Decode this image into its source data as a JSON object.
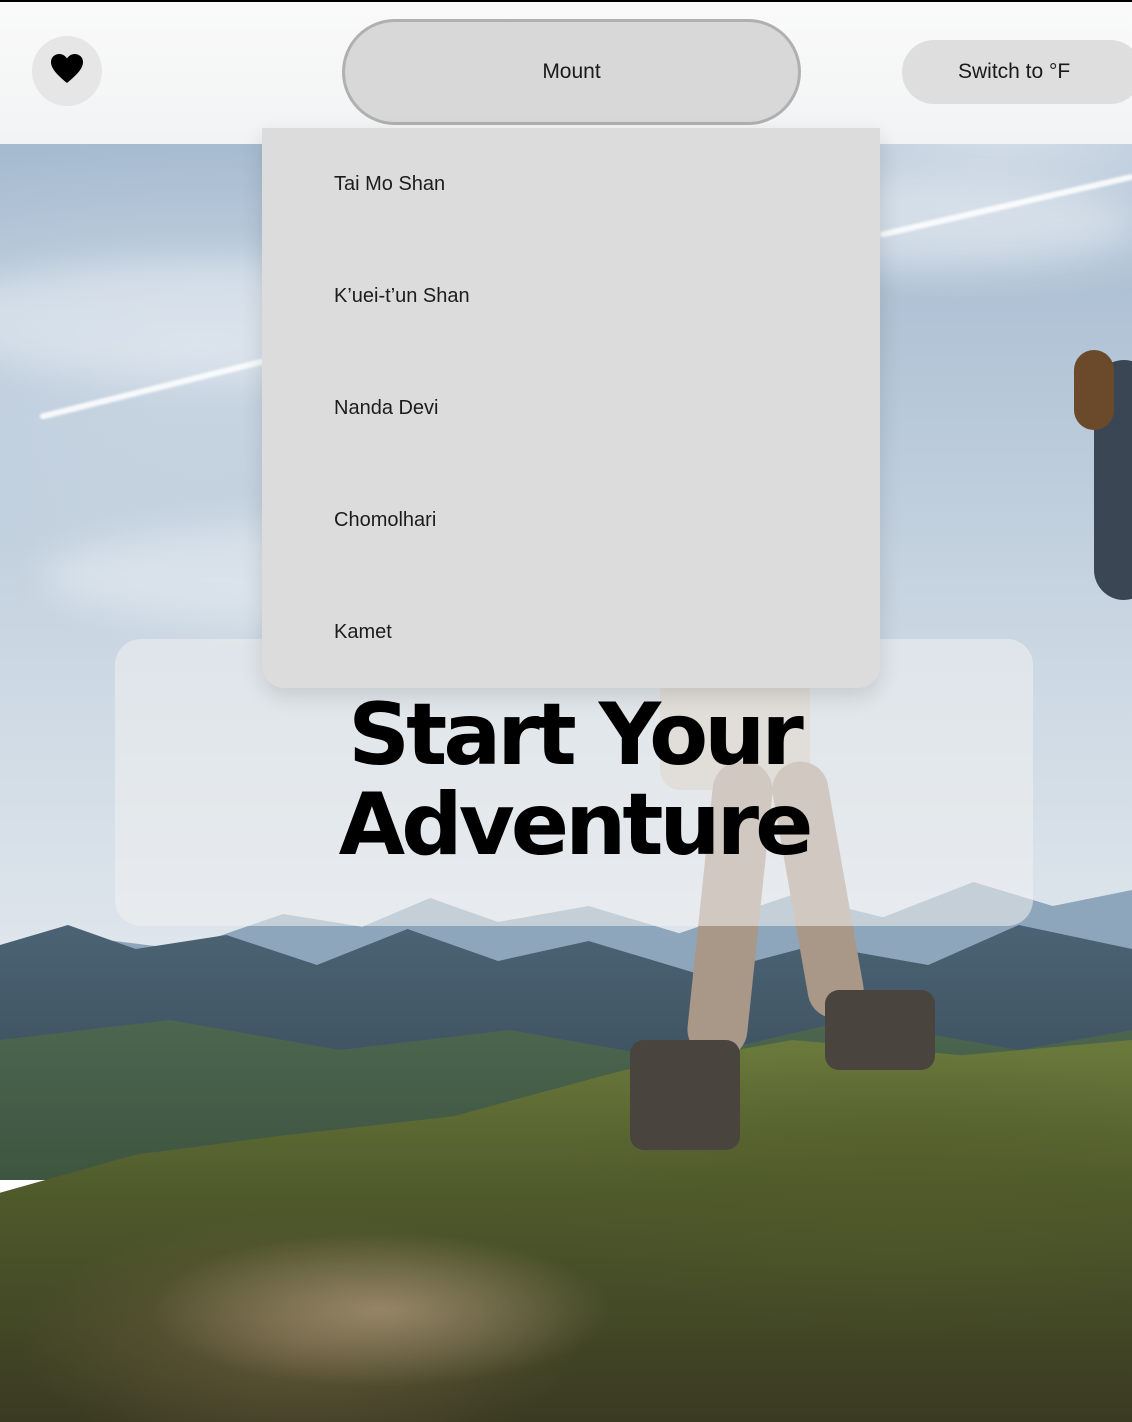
{
  "header": {
    "favorite_icon": "heart-icon",
    "location_select_value": "Mount",
    "unit_toggle_label": "Switch to °F"
  },
  "dropdown": {
    "options": [
      "Tai Mo Shan",
      "K’uei-t’un Shan",
      "Nanda Devi",
      "Chomolhari",
      "Kamet"
    ]
  },
  "hero": {
    "title_line1": "Start Your",
    "title_line2": "Adventure"
  },
  "colors": {
    "topbar": "#f2f3f4",
    "button_bg": "#d9d8d8",
    "dropdown_bg": "#dcdcdc",
    "text": "#1a1a1a"
  }
}
